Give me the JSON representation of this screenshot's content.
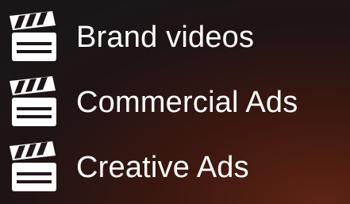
{
  "services": {
    "items": [
      {
        "icon": "clapperboard-icon",
        "label": "Brand videos"
      },
      {
        "icon": "clapperboard-icon",
        "label": "Commercial Ads"
      },
      {
        "icon": "clapperboard-icon",
        "label": "Creative Ads"
      }
    ]
  },
  "colors": {
    "text": "#ffffff",
    "icon": "#ffffff",
    "background_dark": "#1a1618",
    "background_glow": "#5e2414"
  }
}
